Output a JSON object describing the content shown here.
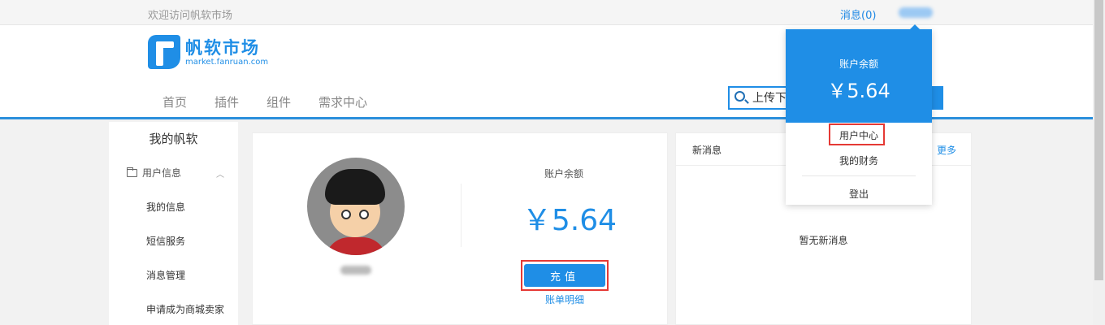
{
  "topbar": {
    "welcome": "欢迎访问帆软市场",
    "messages": "消息(0)"
  },
  "logo": {
    "name": "帆软市场",
    "url": "market.fanruan.com"
  },
  "nav": {
    "items": [
      "首页",
      "插件",
      "组件",
      "需求中心"
    ]
  },
  "search": {
    "value": "上传下"
  },
  "sidebar": {
    "title": "我的帆软",
    "group_label": "用户信息",
    "items": [
      "我的信息",
      "短信服务",
      "消息管理",
      "申请成为商城卖家"
    ]
  },
  "account": {
    "balance_label": "账户余额",
    "balance_value": "￥5.64",
    "recharge_label": "充值",
    "bill_link": "账单明细"
  },
  "messages_panel": {
    "title": "新消息",
    "more": "更多",
    "empty": "暂无新消息"
  },
  "dropdown": {
    "balance_label": "账户余额",
    "balance_value": "￥5.64",
    "items": [
      "用户中心",
      "我的财务",
      "登出"
    ]
  },
  "colors": {
    "accent": "#1f8ee6",
    "highlight_frame": "#e53935"
  }
}
